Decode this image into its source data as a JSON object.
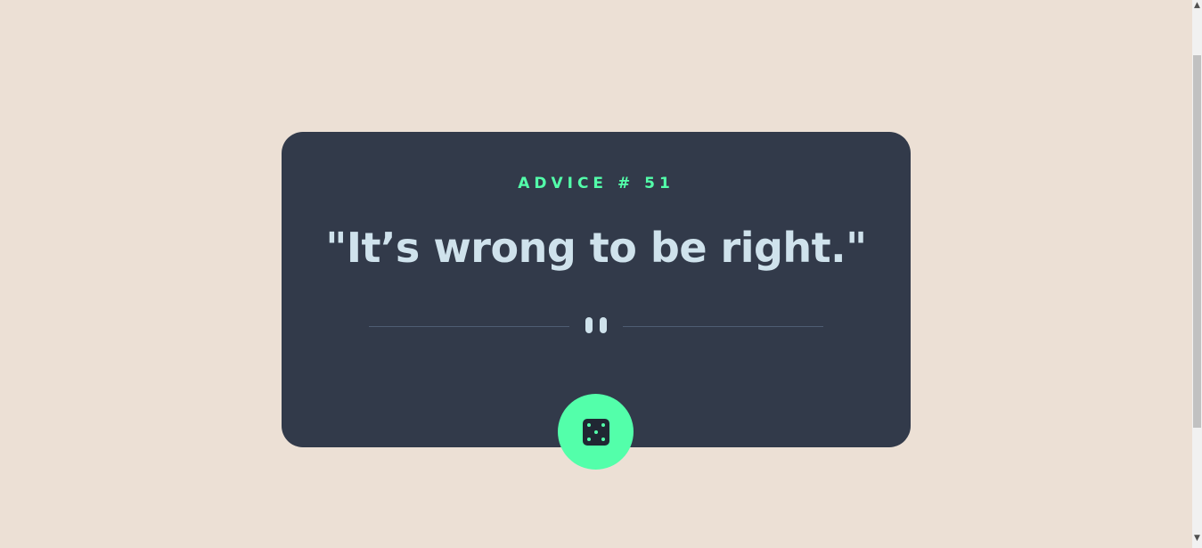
{
  "advice": {
    "id_label": "ADVICE # 51",
    "text": "\"It’s wrong to be right.\""
  },
  "divider": {
    "icon": "pause-icon"
  },
  "dice_button": {
    "icon": "dice-icon"
  },
  "colors": {
    "background": "#ece0d5",
    "card": "#323a4a",
    "accent": "#53ffaa",
    "text": "#cfe2ec",
    "divider_line": "#4e5d73",
    "dice_face": "#202733"
  },
  "scrollbar": {
    "up_arrow": "▲",
    "down_arrow": "▼"
  }
}
